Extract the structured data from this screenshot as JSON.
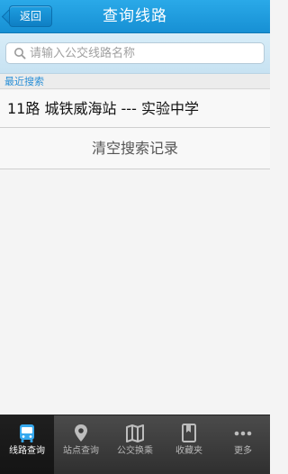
{
  "header": {
    "back_label": "返回",
    "title": "查询线路"
  },
  "search": {
    "placeholder": "请输入公交线路名称",
    "value": ""
  },
  "recent": {
    "label": "最近搜索",
    "items": [
      {
        "text": "11路  城铁威海站 --- 实验中学"
      }
    ]
  },
  "clear_label": "清空搜索记录",
  "bottom_nav": {
    "items": [
      {
        "label": "线路查询",
        "icon": "bus-icon",
        "active": true
      },
      {
        "label": "站点查询",
        "icon": "location-pin-icon",
        "active": false
      },
      {
        "label": "公交换乘",
        "icon": "map-icon",
        "active": false
      },
      {
        "label": "收藏夹",
        "icon": "bookmark-icon",
        "active": false
      },
      {
        "label": "更多",
        "icon": "more-dots-icon",
        "active": false
      }
    ]
  },
  "colors": {
    "header": "#1790d4",
    "accent_text": "#2a8fd6",
    "nav_bg": "#3a3a3a"
  }
}
